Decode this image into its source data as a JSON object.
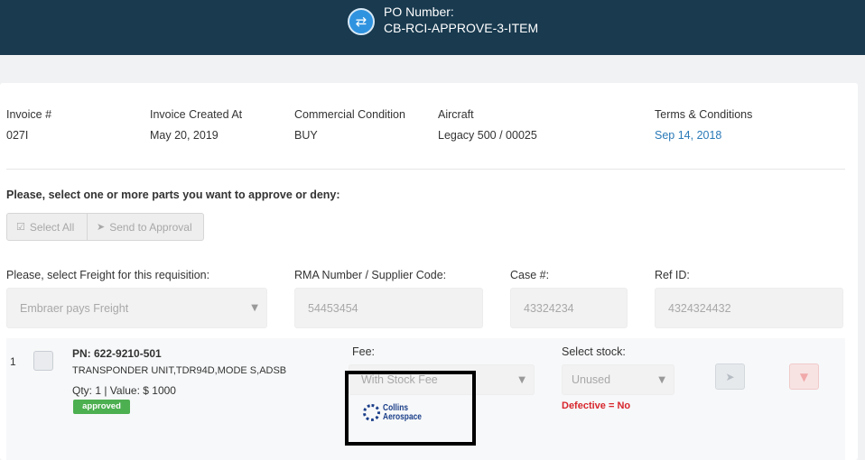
{
  "header": {
    "po_label": "PO Number:",
    "po_value": "CB-RCI-APPROVE-3-ITEM",
    "icon": "swap-arrows-icon"
  },
  "invoice_info": {
    "invoice_label": "Invoice #",
    "invoice_value": "027I",
    "created_label": "Invoice Created At",
    "created_value": "May 20, 2019",
    "condition_label": "Commercial Condition",
    "condition_value": "BUY",
    "aircraft_label": "Aircraft",
    "aircraft_value": "Legacy 500 / 00025",
    "terms_label": "Terms & Conditions",
    "terms_value": "Sep 14, 2018"
  },
  "instructions": "Please, select one or more parts you want to approve or deny:",
  "actions": {
    "select_all": "Select All",
    "send_to_approval": "Send to Approval"
  },
  "requisition": {
    "freight_label": "Please, select Freight for this requisition:",
    "freight_value": "Embraer pays Freight",
    "rma_label": "RMA Number / Supplier Code:",
    "rma_value": "54453454",
    "case_label": "Case #:",
    "case_value": "43324234",
    "ref_label": "Ref ID:",
    "ref_value": "4324324432"
  },
  "items": [
    {
      "index": "1",
      "pn": "PN: 622-9210-501",
      "description": "TRANSPONDER UNIT,TDR94D,MODE S,ADSB",
      "qty_value": "Qty: 1 | Value: $ 1000",
      "status": "approved",
      "fee_label": "Fee:",
      "fee_value": "With Stock Fee",
      "stock_label": "Select stock:",
      "stock_value": "Unused",
      "defective": "Defective = No"
    }
  ],
  "logo": {
    "line1": "Collins",
    "line2": "Aerospace"
  },
  "colors": {
    "header_bg": "#193a4f",
    "link": "#2a7ab8",
    "approved_badge": "#4caf50",
    "defective_text": "#d7262c"
  }
}
